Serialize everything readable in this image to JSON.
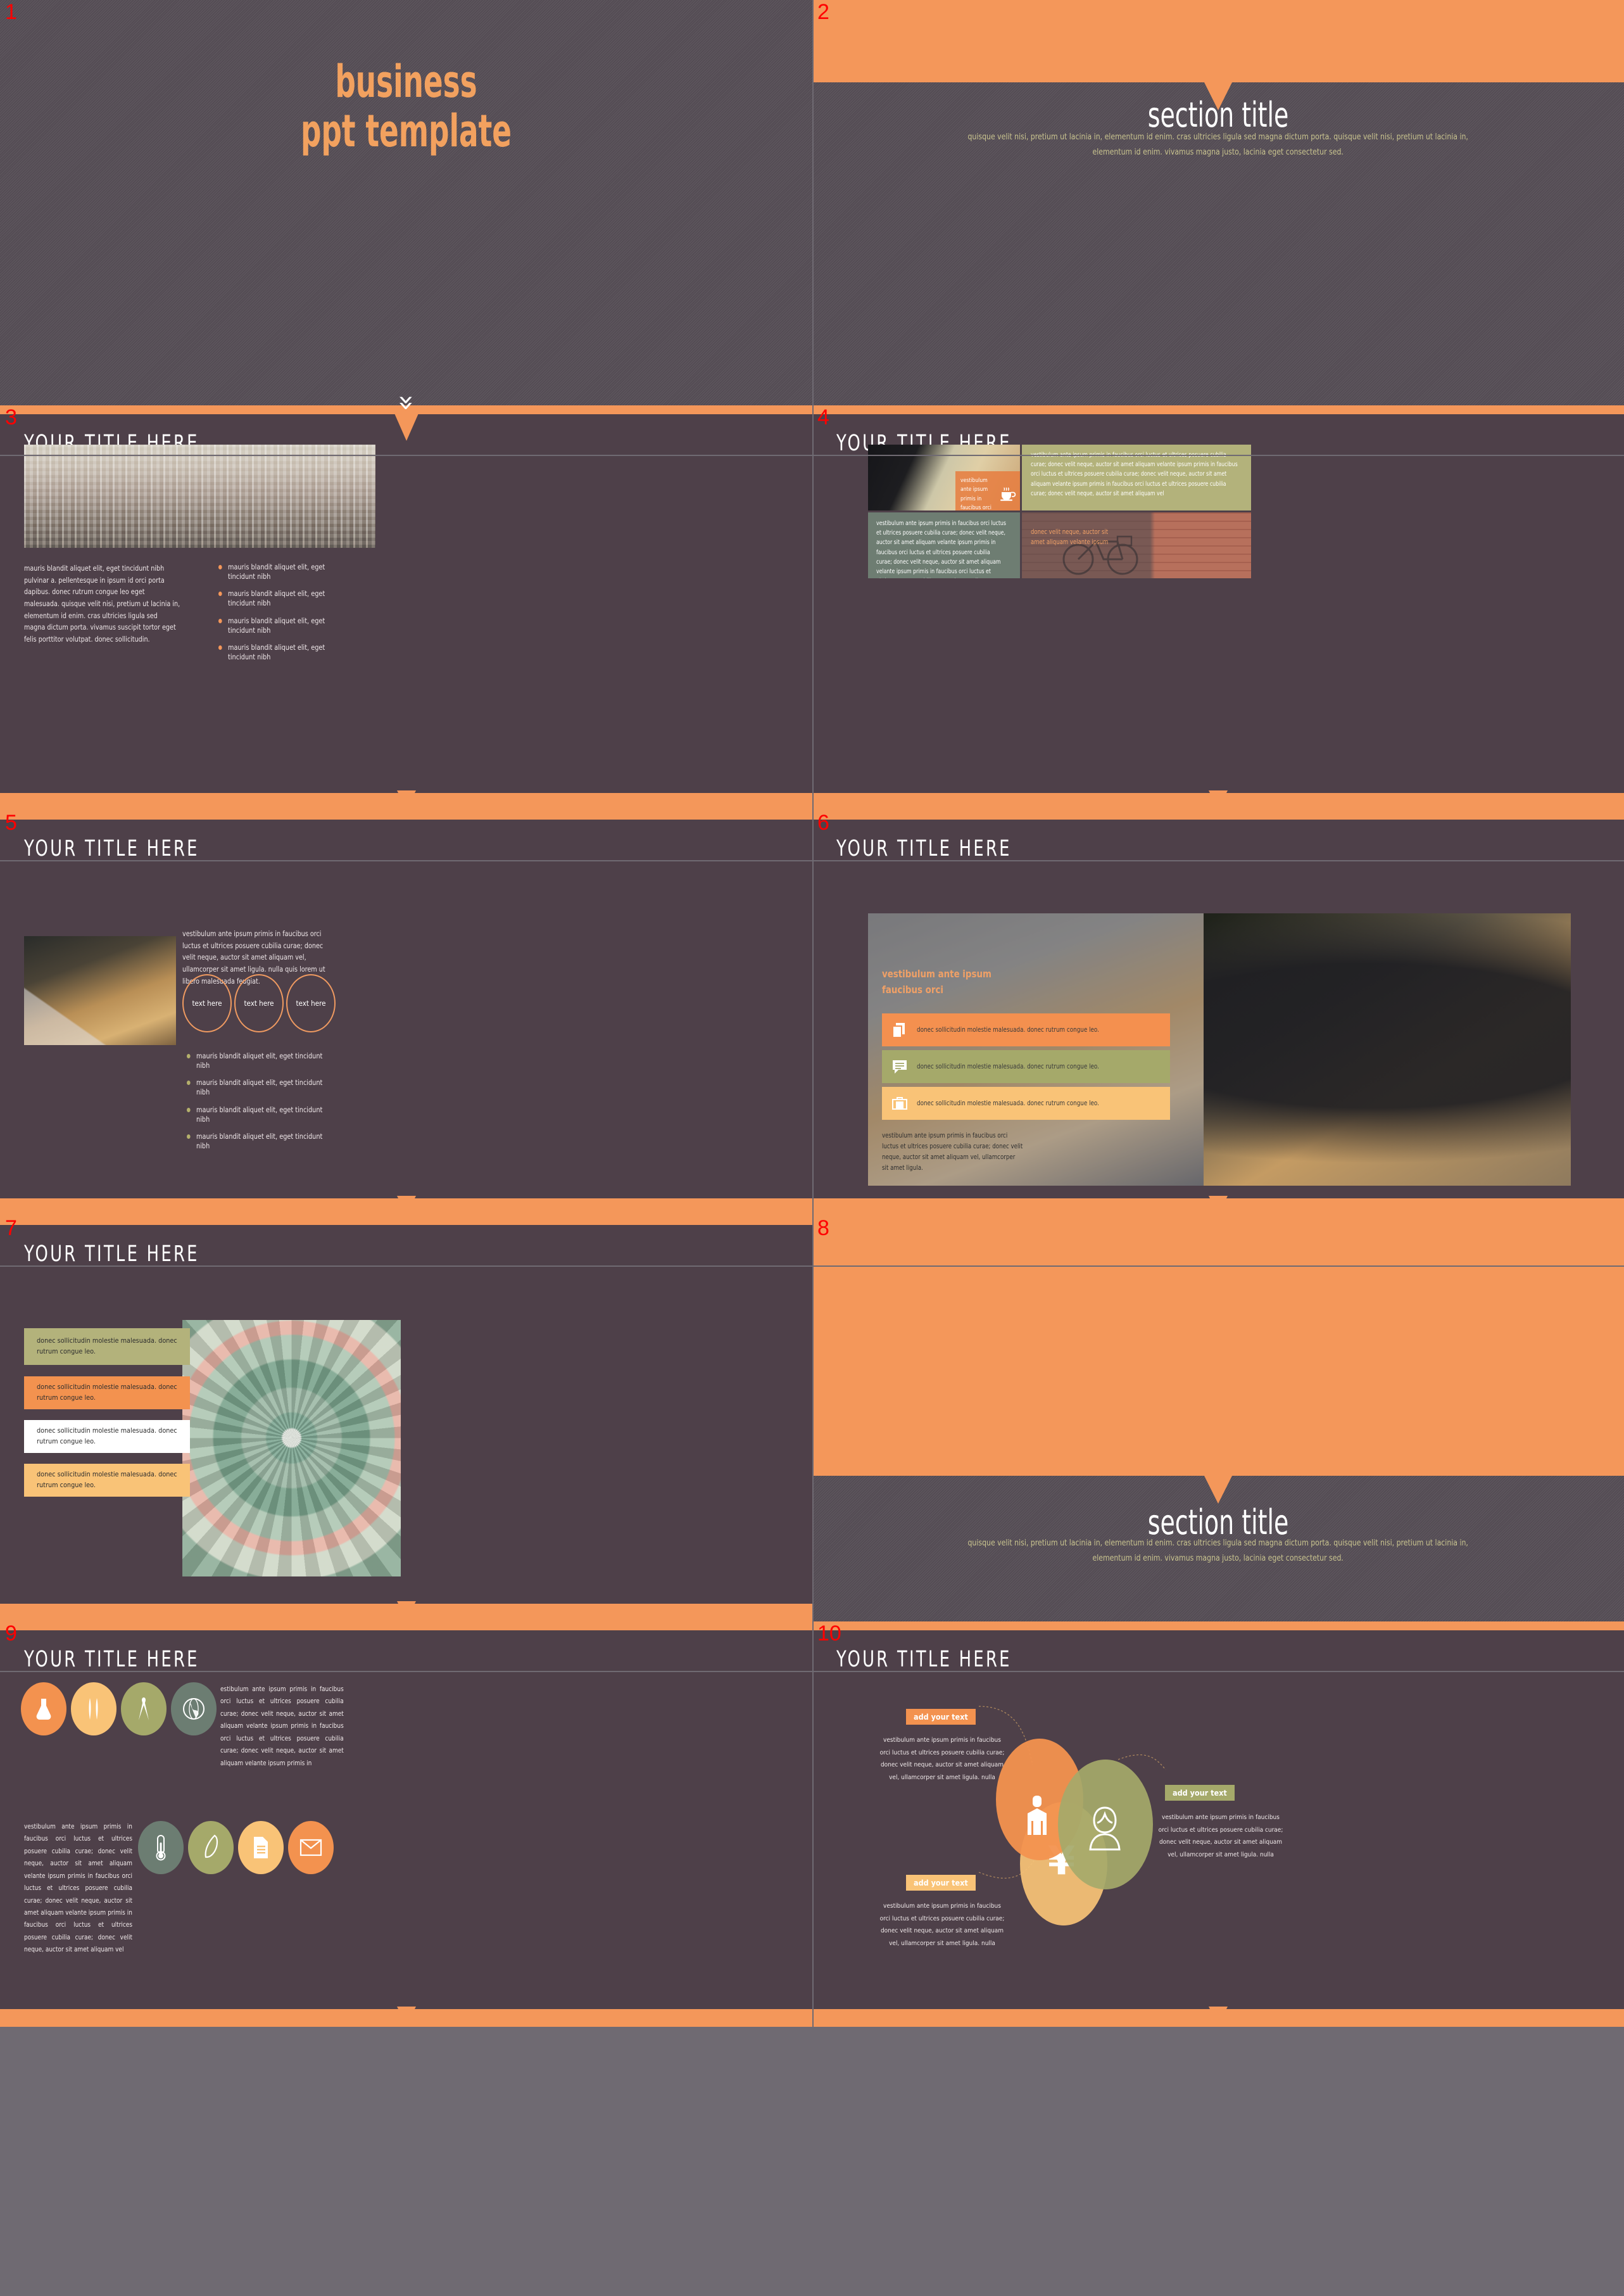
{
  "deck": {
    "cover": {
      "number": "1",
      "title_line1": "business",
      "title_line2": "ppt template",
      "chevron": "»"
    },
    "section_2": {
      "number": "2",
      "title": "section title",
      "subtitle": "quisque velit nisi, pretium ut lacinia in, elementum id enim. cras ultricies ligula sed magna dictum porta. quisque velit nisi, pretium ut lacinia in, elementum id enim. vivamus magna justo, lacinia eget consectetur sed."
    },
    "slide_3": {
      "number": "3",
      "title": "YOUR  TITLE  HERE",
      "paragraph": "mauris blandit aliquet elit, eget tincidunt nibh pulvinar a. pellentesque in ipsum id orci porta dapibus. donec rutrum congue leo eget malesuada. quisque velit nisi, pretium ut lacinia in, elementum id enim. cras ultricies ligula sed magna dictum porta. vivamus suscipit tortor eget felis porttitor volutpat. donec sollicitudin.",
      "bullets": [
        "mauris blandit aliquet elit, eget tincidunt nibh",
        "mauris blandit aliquet elit, eget tincidunt nibh",
        "mauris blandit aliquet elit, eget tincidunt nibh",
        "mauris blandit aliquet elit, eget tincidunt nibh"
      ]
    },
    "slide_4": {
      "number": "4",
      "title": "YOUR  TITLE  HERE",
      "overlay_caption": "vestibulum ante ipsum primis in faucibus orci",
      "olive_text": "vestibulum ante ipsum primis in faucibus orci luctus et ultrices posuere cubilia curae; donec velit neque, auctor sit amet aliquam velante ipsum primis in faucibus orci luctus et ultrices posuere cubilia curae; donec velit neque, auctor sit amet aliquam velante ipsum primis in faucibus orci luctus et ultrices posuere cubilia curae; donec velit neque, auctor sit amet aliquam vel",
      "grey_text": "vestibulum ante ipsum primis in faucibus orci luctus et ultrices posuere cubilia curae; donec velit neque, auctor sit amet aliquam velante ipsum primis in faucibus orci luctus et ultrices posuere cubilia curae; donec velit neque, auctor sit amet aliquam velante ipsum primis in faucibus orci luctus et ultrices posuere cubilia curae; donec velit neque, auctor sit amet aliquam vel",
      "brick_caption": "donec velit neque, auctor sit amet aliquam velante ipsum",
      "cup_icon": "coffee-cup-icon"
    },
    "slide_5": {
      "number": "5",
      "title": "YOUR  TITLE  HERE",
      "paragraph": "vestibulum ante ipsum primis in faucibus orci luctus et ultrices posuere cubilia curae; donec velit neque, auctor sit amet aliquam vel, ullamcorper sit amet ligula. nulla quis lorem ut libero malesuada feugiat.",
      "circles": [
        "text here",
        "text here",
        "text here"
      ],
      "bullets": [
        "mauris blandit aliquet elit, eget tincidunt nibh",
        "mauris blandit aliquet elit, eget tincidunt nibh",
        "mauris blandit aliquet elit, eget tincidunt nibh",
        "mauris blandit aliquet elit, eget tincidunt nibh"
      ]
    },
    "slide_6": {
      "number": "6",
      "title": "YOUR  TITLE  HERE",
      "headline": "vestibulum ante ipsum faucibus orci",
      "chips": [
        {
          "icon": "copy-icon",
          "text": "donec sollicitudin molestie malesuada. donec rutrum congue leo.",
          "color": "#f4904f"
        },
        {
          "icon": "speech-bubble-icon",
          "text": "donec sollicitudin molestie malesuada. donec rutrum congue leo.",
          "color": "#a5a96a"
        },
        {
          "icon": "briefcase-icon",
          "text": "donec sollicitudin molestie malesuada. donec rutrum congue leo.",
          "color": "#f9c377"
        }
      ],
      "footer": "vestibulum ante ipsum primis in faucibus orci luctus et ultrices posuere cubilia curae; donec velit neque, auctor sit amet aliquam vel, ullamcorper sit amet ligula."
    },
    "slide_7": {
      "number": "7",
      "title": "YOUR  TITLE  HERE",
      "bands": [
        {
          "text": "donec sollicitudin molestie malesuada. donec rutrum congue leo.",
          "color": "#b3b27b"
        },
        {
          "text": "donec sollicitudin molestie malesuada. donec rutrum congue leo.",
          "color": "#f3924f"
        },
        {
          "text": "donec sollicitudin molestie malesuada. donec rutrum congue leo.",
          "color": "#ffffff"
        },
        {
          "text": "donec sollicitudin molestie malesuada. donec rutrum congue leo.",
          "color": "#f9c377"
        }
      ]
    },
    "section_8": {
      "number": "8",
      "title": "section title",
      "subtitle": "quisque velit nisi, pretium ut lacinia in, elementum id enim. cras ultricies ligula sed magna dictum porta. quisque velit nisi, pretium ut lacinia in, elementum id enim. vivamus magna justo, lacinia eget consectetur sed."
    },
    "slide_9": {
      "number": "9",
      "title": "YOUR  TITLE  HERE",
      "icons_row1": [
        {
          "name": "flask-icon",
          "glyph": "⚗",
          "color": "#f3924f"
        },
        {
          "name": "pens-icon",
          "glyph": "‖",
          "color": "#f9c377"
        },
        {
          "name": "compass-icon",
          "glyph": "⋀",
          "color": "#a5a96a"
        },
        {
          "name": "globe-icon",
          "glyph": "♁",
          "color": "#6c7d72"
        }
      ],
      "icons_row2": [
        {
          "name": "thermometer-icon",
          "glyph": "⚕",
          "color": "#6c7d72"
        },
        {
          "name": "feather-icon",
          "glyph": "✒",
          "color": "#a5a96a"
        },
        {
          "name": "document-icon",
          "glyph": "☰",
          "color": "#f9c377"
        },
        {
          "name": "envelope-icon",
          "glyph": "✉",
          "color": "#f3924f"
        }
      ],
      "text_right": "estibulum ante ipsum primis in faucibus orci luctus et ultrices posuere cubilia curae; donec velit neque, auctor sit amet aliquam velante ipsum primis in faucibus orci luctus et ultrices posuere cubilia curae; donec velit neque, auctor sit amet aliquam velante ipsum primis in",
      "text_left": "vestibulum ante ipsum primis in faucibus orci luctus et ultrices posuere cubilia curae; donec velit neque, auctor sit amet aliquam velante ipsum primis in faucibus orci luctus et ultrices posuere cubilia curae; donec velit neque, auctor sit amet aliquam velante ipsum primis in faucibus orci luctus et ultrices posuere cubilia curae; donec velit neque, auctor sit amet aliquam vel"
    },
    "slide_10": {
      "number": "10",
      "title": "YOUR  TITLE  HERE",
      "items": [
        {
          "tag": "add your text",
          "tag_color": "#f3924f",
          "body": "vestibulum ante ipsum primis in faucibus orci luctus et ultrices posuere cubilia curae; donec velit neque, auctor sit amet aliquam vel, ullamcorper sit amet ligula. nulla"
        },
        {
          "tag": "add your text",
          "tag_color": "#a5a96a",
          "body": "vestibulum ante ipsum primis in faucibus orci luctus et ultrices posuere cubilia curae; donec velit neque, auctor sit amet aliquam vel, ullamcorper sit amet ligula. nulla"
        },
        {
          "tag": "add your text",
          "tag_color": "#f9c377",
          "body": "vestibulum ante ipsum primis in faucibus orci luctus et ultrices posuere cubilia curae; donec velit neque, auctor sit amet aliquam vel, ullamcorper sit amet ligula. nulla"
        }
      ],
      "venn_icons": [
        {
          "name": "businessman-icon",
          "glyph": "☲",
          "color": "#f3924f"
        },
        {
          "name": "businesswoman-icon",
          "glyph": "☿",
          "color": "#a5a96a"
        },
        {
          "name": "yen-currency-icon",
          "glyph": "¥",
          "color": "#f9c377"
        }
      ]
    }
  },
  "palette": {
    "orange": "#f4975a",
    "orange_dark": "#f3924f",
    "olive": "#a5a96a",
    "olive_light": "#b3b27b",
    "yellow": "#f9c377",
    "grey_green": "#6c7d72",
    "bg_dark": "#4e4049",
    "bg_texture": "#585058",
    "slide_number": "#ff0000"
  }
}
